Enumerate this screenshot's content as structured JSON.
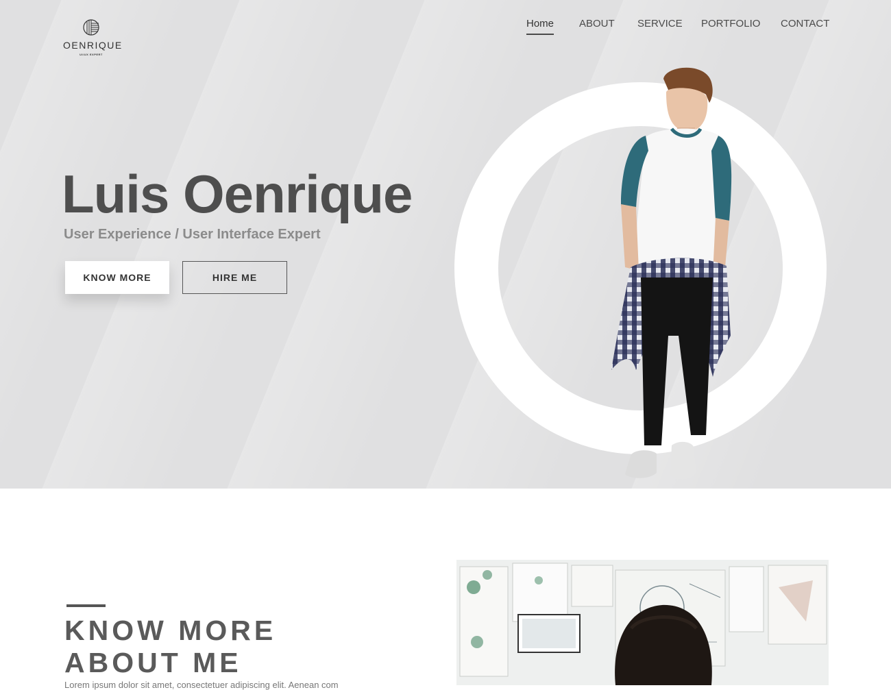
{
  "logo": {
    "name": "OENRIQUE",
    "tagline": "UI/UX EXPERT",
    "icon": "striped-circle-logo-icon"
  },
  "nav": {
    "items": [
      {
        "label": "Home",
        "active": true
      },
      {
        "label": "ABOUT",
        "active": false
      },
      {
        "label": "SERVICE",
        "active": false
      },
      {
        "label": "PORTFOLIO",
        "active": false
      },
      {
        "label": "CONTACT",
        "active": false
      }
    ]
  },
  "hero": {
    "name": "Luis Oenrique",
    "subtitle": "User Experience / User Interface Expert",
    "know_more_label": "KNOW MORE",
    "hire_me_label": "HIRE ME"
  },
  "about": {
    "title_line1": "KNOW MORE",
    "title_line2": "ABOUT ME",
    "text": "Lorem ipsum dolor sit amet, consectetuer adipiscing elit. Aenean com"
  },
  "colors": {
    "hero_background": "#e0e0e1",
    "heading": "#4e4e4e",
    "subtitle": "#8b8b8b",
    "ring": "#ffffff",
    "accent_teal": "#2e6b7a"
  }
}
